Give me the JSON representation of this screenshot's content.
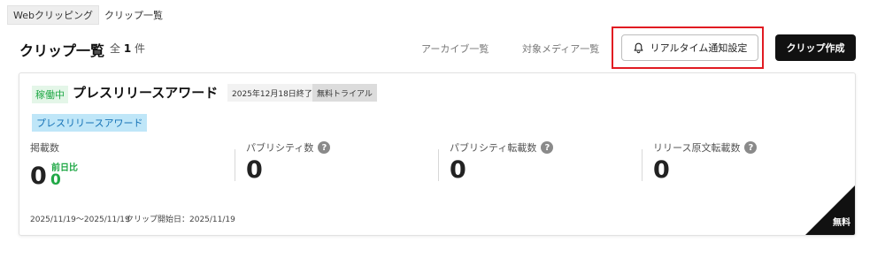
{
  "breadcrumb": {
    "link_label": "Webクリッピング",
    "current_label": "クリップ一覧"
  },
  "header": {
    "title": "クリップ一覧",
    "count_prefix": "全",
    "count_value": "1",
    "count_suffix": "件",
    "nav": {
      "archive_label": "アーカイブ一覧",
      "media_label": "対象メディア一覧"
    },
    "notify_button_label": "リアルタイム通知設定",
    "notify_icon": "bell-icon",
    "create_button_label": "クリップ作成",
    "highlight_color": "#e11b22"
  },
  "card": {
    "status": "稼働中",
    "title": "プレスリリースアワード",
    "end_tag": "2025年12月18日終了",
    "trial_tag": "無料トライアル",
    "keyword": "プレスリリースアワード",
    "metrics": {
      "m1": {
        "label": "掲載数",
        "value": "0"
      },
      "m2": {
        "label": "パブリシティ数",
        "value": "0"
      },
      "m3": {
        "label": "パブリシティ転載数",
        "value": "0"
      },
      "m4": {
        "label": "リリース原文転載数",
        "value": "0"
      }
    },
    "help_glyph": "?",
    "daybefore": {
      "label": "前日比",
      "value": "0"
    },
    "period": "2025/11/19〜2025/11/19",
    "start_date": "クリップ開始日：2025/11/19",
    "plan_label": "無料"
  },
  "colors": {
    "status_green": "#20a846",
    "keyword_blue": "#1572b6",
    "keyword_bg": "#bfe6f8"
  }
}
